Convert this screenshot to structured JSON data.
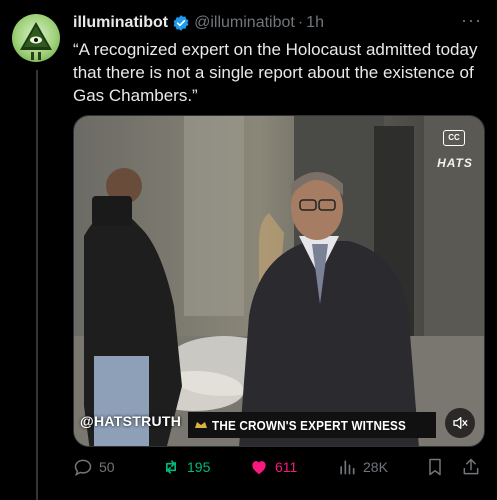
{
  "user": {
    "display_name": "illuminatibot",
    "handle": "@illuminatibot",
    "separator": "·",
    "time": "1h",
    "verified": true,
    "verified_color": "#1d9bf0",
    "avatar_icon": "illuminati-eye-pyramid-icon"
  },
  "tweet": {
    "text": "“A recognized expert on the Holocaust admitted today that there is not a single report about the existence of Gas Chambers.”"
  },
  "media": {
    "watermark": "@HATSTRUTH",
    "caption": "THE CROWN'S EXPERT WITNESS",
    "channel_logo": "HATS",
    "cc_label": "CC",
    "mute_icon": "speaker-muted-icon"
  },
  "actions": {
    "replies": "50",
    "retweets": "195",
    "likes": "611",
    "views": "28K",
    "retweet_color": "#00ba7c",
    "like_color": "#f91880",
    "muted_color": "#71767b"
  }
}
